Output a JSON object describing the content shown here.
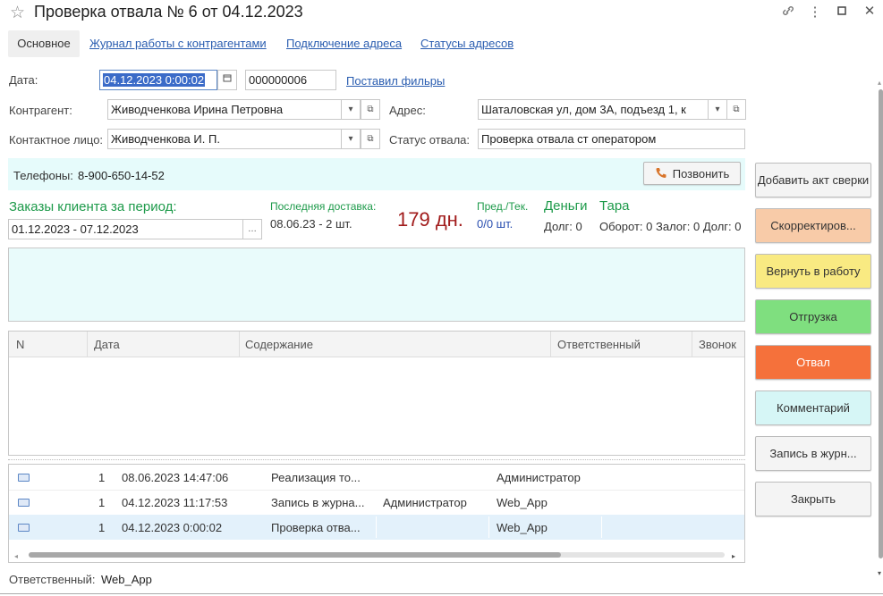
{
  "window": {
    "title": "Проверка отвала № 6 от 04.12.2023"
  },
  "tabs": [
    {
      "label": "Основное"
    },
    {
      "label": "Журнал работы с контрагентами"
    },
    {
      "label": "Подключение адреса"
    },
    {
      "label": "Статусы адресов"
    }
  ],
  "form": {
    "date_label": "Дата:",
    "date_value": "04.12.2023  0:00:02",
    "number_value": "000000006",
    "filters_link": "Поставил фильры",
    "contractor_label": "Контрагент:",
    "contractor_value": "Живодченкова Ирина Петровна",
    "address_label": "Адрес:",
    "address_value": "Шаталовская ул,  дом 3А,  подъезд 1,  к",
    "contact_label": "Контактное лицо:",
    "contact_value": "Живодченкова И. П.",
    "status_label": "Статус отвала:",
    "status_value": "Проверка отвала ст оператором"
  },
  "phone": {
    "label": "Телефоны:",
    "value": "8-900-650-14-52",
    "call_button": "Позвонить"
  },
  "orders": {
    "title": "Заказы клиента за период:",
    "period": "01.12.2023 - 07.12.2023",
    "last_delivery_label": "Последняя доставка:",
    "last_delivery_value": "08.06.23 - 2 шт.",
    "days": "179 дн.",
    "prev_label": "Пред./Тек.",
    "prev_value": "0/0 шт.",
    "money_label": "Деньги",
    "money_debt": "Долг: 0",
    "tara_label": "Тара",
    "tara_values": "Оборот: 0 Залог: 0 Долг: 0"
  },
  "calls_table": {
    "columns": [
      "N",
      "Дата",
      "Содержание",
      "Ответственный",
      "Звонок"
    ]
  },
  "docs_table": {
    "rows": [
      {
        "n": "1",
        "date": "08.06.2023 14:47:06",
        "doc": "Реализация то...",
        "user": "",
        "resp": "Администратор"
      },
      {
        "n": "1",
        "date": "04.12.2023 11:17:53",
        "doc": "Запись в журна...",
        "user": "Администратор",
        "resp": "Web_App"
      },
      {
        "n": "1",
        "date": "04.12.2023 0:00:02",
        "doc": "Проверка отва...",
        "user": "",
        "resp": "Web_App"
      }
    ]
  },
  "footer": {
    "responsible_label": "Ответственный:",
    "responsible_value": "Web_App"
  },
  "actions": [
    {
      "label": "Добавить акт сверки",
      "bg": "#f4f4f4"
    },
    {
      "label": "Скорректиров...",
      "bg": "#f8cba8"
    },
    {
      "label": "Вернуть в работу",
      "bg": "#f9ea82"
    },
    {
      "label": "Отгрузка",
      "bg": "#7fdf7f"
    },
    {
      "label": "Отвал",
      "bg": "#f5713b"
    },
    {
      "label": "Комментарий",
      "bg": "#d6f6f6"
    },
    {
      "label": "Запись в журн...",
      "bg": "#f4f4f4"
    },
    {
      "label": "Закрыть",
      "bg": "#f4f4f4"
    }
  ]
}
